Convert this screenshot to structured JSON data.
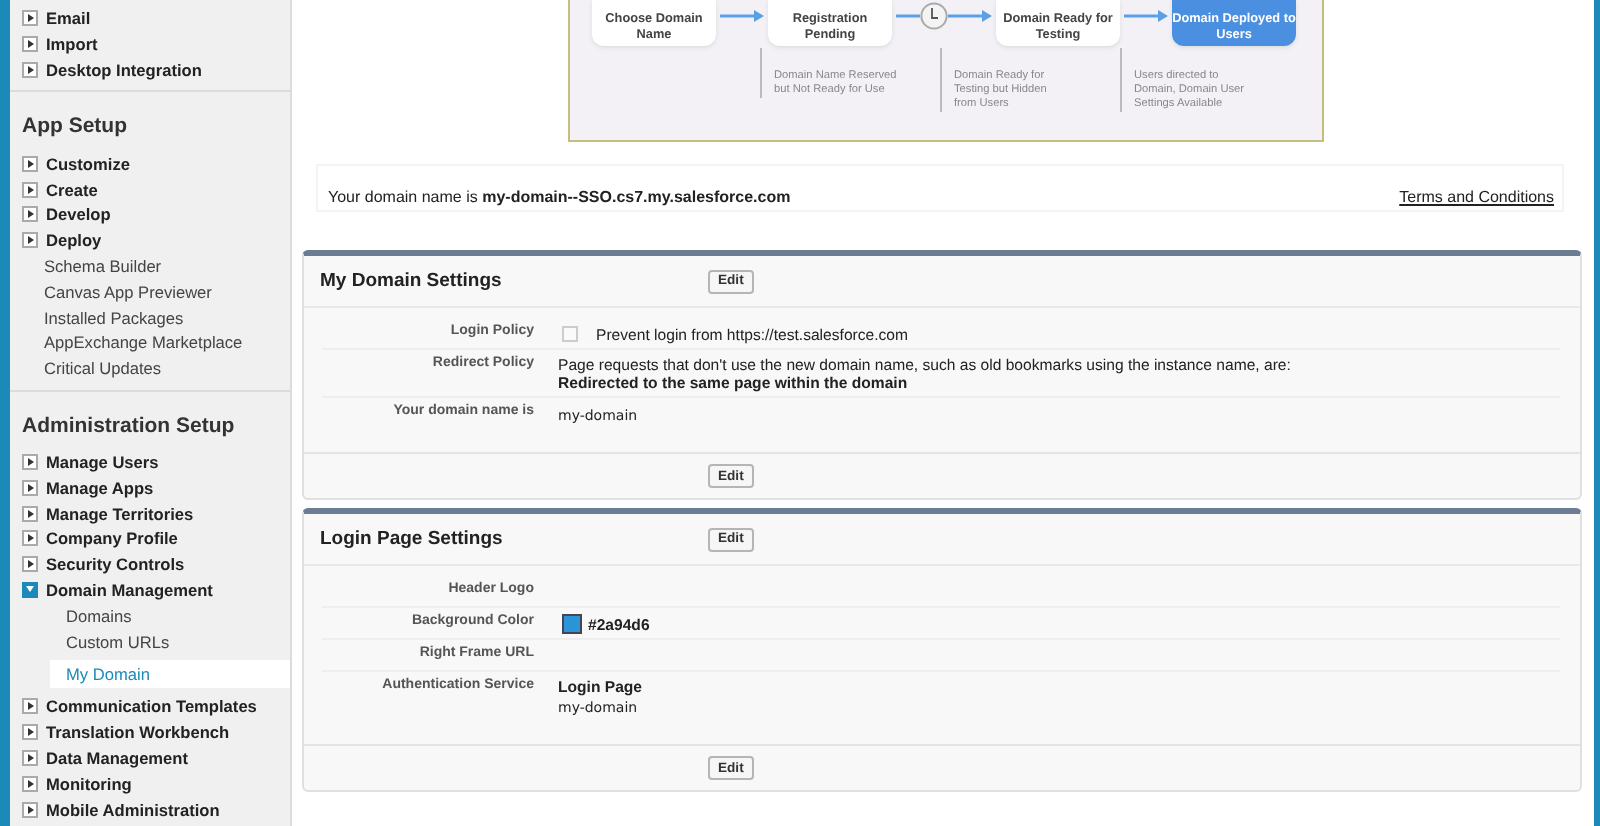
{
  "sidebar": {
    "groups": [
      {
        "items": [
          {
            "label": "Email",
            "kind": "expandable",
            "expanded": false
          },
          {
            "label": "Import",
            "kind": "expandable",
            "expanded": false
          },
          {
            "label": "Desktop Integration",
            "kind": "expandable",
            "expanded": false
          }
        ]
      },
      {
        "title": "App Setup",
        "items": [
          {
            "label": "Customize",
            "kind": "expandable",
            "expanded": false
          },
          {
            "label": "Create",
            "kind": "expandable",
            "expanded": false
          },
          {
            "label": "Develop",
            "kind": "expandable",
            "expanded": false
          },
          {
            "label": "Deploy",
            "kind": "expandable",
            "expanded": false
          },
          {
            "label": "Schema Builder",
            "kind": "link",
            "selected": false
          },
          {
            "label": "Canvas App Previewer",
            "kind": "link",
            "selected": false
          },
          {
            "label": "Installed Packages",
            "kind": "link",
            "selected": false
          },
          {
            "label": "AppExchange Marketplace",
            "kind": "link",
            "selected": false
          },
          {
            "label": "Critical Updates",
            "kind": "link",
            "selected": false
          }
        ]
      },
      {
        "title": "Administration Setup",
        "items": [
          {
            "label": "Manage Users",
            "kind": "expandable",
            "expanded": false
          },
          {
            "label": "Manage Apps",
            "kind": "expandable",
            "expanded": false
          },
          {
            "label": "Manage Territories",
            "kind": "expandable",
            "expanded": false
          },
          {
            "label": "Company Profile",
            "kind": "expandable",
            "expanded": false
          },
          {
            "label": "Security Controls",
            "kind": "expandable",
            "expanded": false
          },
          {
            "label": "Domain Management",
            "kind": "expandable",
            "expanded": true,
            "children": [
              {
                "label": "Domains",
                "kind": "link",
                "selected": false
              },
              {
                "label": "Custom URLs",
                "kind": "link",
                "selected": false
              },
              {
                "label": "My Domain",
                "kind": "link",
                "selected": true
              }
            ]
          },
          {
            "label": "Communication Templates",
            "kind": "expandable",
            "expanded": false
          },
          {
            "label": "Translation Workbench",
            "kind": "expandable",
            "expanded": false
          },
          {
            "label": "Data Management",
            "kind": "expandable",
            "expanded": false
          },
          {
            "label": "Monitoring",
            "kind": "expandable",
            "expanded": false
          },
          {
            "label": "Mobile Administration",
            "kind": "expandable",
            "expanded": false
          }
        ]
      }
    ]
  },
  "diagram": {
    "steps": [
      {
        "label": "Choose Domain Name",
        "current": false
      },
      {
        "label": "Registration Pending",
        "current": false,
        "note": "Domain Name Reserved but Not Ready for Use",
        "wait": true
      },
      {
        "label": "Domain Ready for Testing",
        "current": false,
        "note": "Domain Ready for Testing but Hidden from Users"
      },
      {
        "label": "Domain Deployed to Users",
        "current": true,
        "note": "Users directed to Domain, Domain User Settings Available"
      }
    ]
  },
  "domain_bar": {
    "text": "Your domain name is **my-domain--SSO.cs7.my.salesforce.com**",
    "link": "Terms and Conditions"
  },
  "sections": [
    {
      "title": "My Domain Settings",
      "button": "Edit",
      "footer_button": "Edit",
      "fields": [
        {
          "label": "Login Policy",
          "kind": "checkbox",
          "checked": false,
          "text": "Prevent login from https://test.salesforce.com"
        },
        {
          "label": "Redirect Policy",
          "kind": "lines",
          "lines": [
            {
              "text": "Page requests that don't use the new domain name, such as old bookmarks using the instance name, are:",
              "bold": false
            },
            {
              "text": "Redirected to the same page within the domain",
              "bold": true
            }
          ]
        },
        {
          "label": "Your domain name is",
          "kind": "lines",
          "lines": [
            {
              "text": "my-domain",
              "bold": false,
              "mono": true
            }
          ]
        }
      ]
    },
    {
      "title": "Login Page Settings",
      "button": "Edit",
      "footer_button": "Edit",
      "fields": [
        {
          "label": "Header Logo",
          "kind": "lines"
        },
        {
          "label": "Background Color",
          "kind": "color",
          "color": "#2a94d6",
          "text": "#2a94d6"
        },
        {
          "label": "Right Frame URL",
          "kind": "lines"
        },
        {
          "label": "Authentication Service",
          "kind": "lines",
          "lines": [
            {
              "text": "Login Page",
              "bold": true
            },
            {
              "text": "my-domain",
              "bold": false,
              "mono": true
            }
          ]
        }
      ]
    }
  ]
}
